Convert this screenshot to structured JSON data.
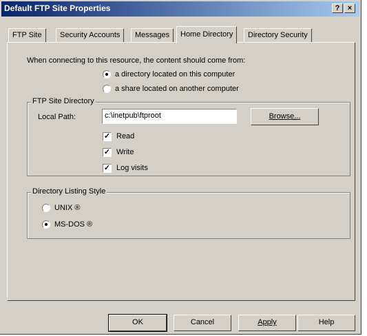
{
  "window": {
    "title": "Default FTP Site Properties",
    "help_button": "?",
    "close_button": "×"
  },
  "tabs": [
    {
      "label": "FTP Site",
      "active": false
    },
    {
      "label": "Security Accounts",
      "active": false
    },
    {
      "label": "Messages",
      "active": false
    },
    {
      "label": "Home Directory",
      "active": true
    },
    {
      "label": "Directory Security",
      "active": false
    }
  ],
  "home_directory": {
    "prompt": "When connecting to this resource, the content should come from:",
    "source_options": [
      {
        "label": "a directory located on this computer",
        "selected": true
      },
      {
        "label": "a share located on another computer",
        "selected": false
      }
    ],
    "ftp_site_directory": {
      "legend": "FTP Site Directory",
      "local_path_label": "Local Path:",
      "local_path_value": "c:\\inetpub\\ftproot",
      "browse_button": "Browse...",
      "permissions": [
        {
          "label": "Read",
          "checked": true
        },
        {
          "label": "Write",
          "checked": true
        },
        {
          "label": "Log visits",
          "checked": true
        }
      ]
    },
    "directory_listing_style": {
      "legend": "Directory Listing Style",
      "options": [
        {
          "label": "UNIX ®",
          "selected": false
        },
        {
          "label": "MS-DOS ®",
          "selected": true
        }
      ]
    }
  },
  "footer_buttons": {
    "ok": "OK",
    "cancel": "Cancel",
    "apply": "Apply",
    "help": "Help"
  }
}
